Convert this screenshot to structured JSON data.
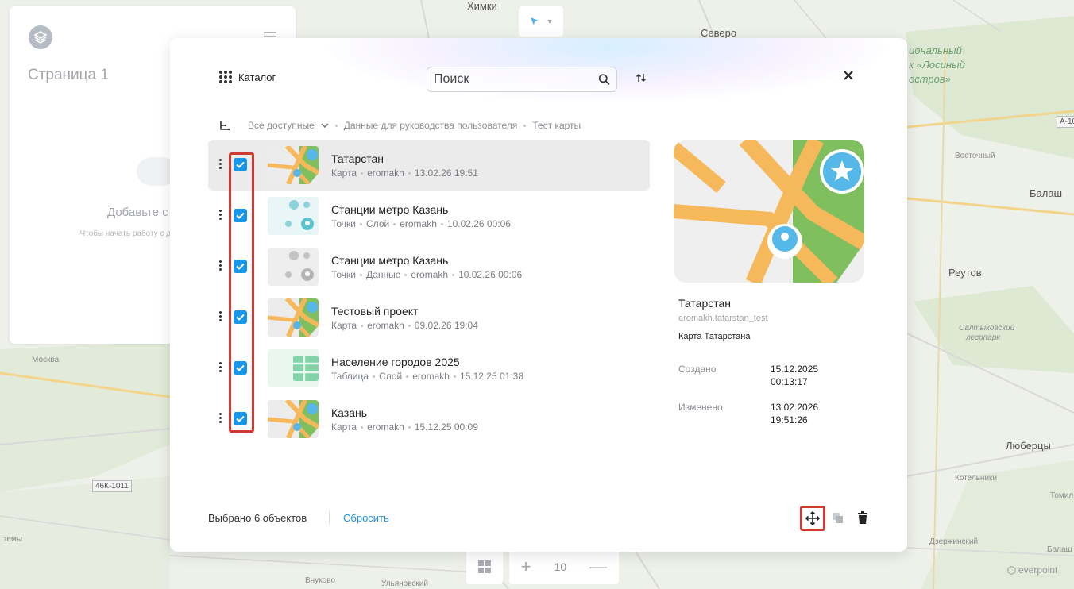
{
  "map": {
    "labels": {
      "khimki": "Химки",
      "severo": "Северо",
      "park_line1": "иональный",
      "park_line2": "к «Лосиный",
      "park_line3": "остров»",
      "vostochny": "Восточный",
      "balash": "Балаш",
      "reutov": "Реутов",
      "saltykovsky1": "Салтыковский",
      "saltykovsky2": "лесопарк",
      "lyubertsy": "Люберцы",
      "kotelniki": "Котельники",
      "tomil": "Томил",
      "dzerzhinsky": "Дзержинский",
      "balash2": "Балаш",
      "vnukovo": "Внуково",
      "ulyanovsky": "Ульяновский",
      "zemy": "земы",
      "moskva": "Москва",
      "road_46k": "46К-1011",
      "road_a10": "А-10"
    }
  },
  "left_panel": {
    "page_title": "Страница 1",
    "add_title": "Добавьте с",
    "hint": "Чтобы начать работу с добавьте слои к"
  },
  "bottom_controls": {
    "zoom_level": "10",
    "brand": "everpoint"
  },
  "catalog": {
    "title": "Каталог",
    "search_placeholder": "Поиск",
    "breadcrumb": {
      "root": "Все доступные",
      "items": [
        "Данные для руководства пользователя",
        "Тест карты"
      ]
    },
    "items": [
      {
        "name": "Татарстан",
        "meta": [
          "Карта",
          "eromakh",
          "13.02.26 19:51"
        ],
        "thumb": "map",
        "selected": true,
        "checked": true
      },
      {
        "name": "Станции метро Казань",
        "meta": [
          "Точки",
          "Слой",
          "eromakh",
          "10.02.26 00:06"
        ],
        "thumb": "points-teal",
        "selected": false,
        "checked": true
      },
      {
        "name": "Станции метро Казань",
        "meta": [
          "Точки",
          "Данные",
          "eromakh",
          "10.02.26 00:06"
        ],
        "thumb": "points-gray",
        "selected": false,
        "checked": true
      },
      {
        "name": "Тестовый проект",
        "meta": [
          "Карта",
          "eromakh",
          "09.02.26 19:04"
        ],
        "thumb": "map",
        "selected": false,
        "checked": true
      },
      {
        "name": "Население городов 2025",
        "meta": [
          "Таблица",
          "Слой",
          "eromakh",
          "15.12.25 01:38"
        ],
        "thumb": "table",
        "selected": false,
        "checked": true
      },
      {
        "name": "Казань",
        "meta": [
          "Карта",
          "eromakh",
          "15.12.25 00:09"
        ],
        "thumb": "map",
        "selected": false,
        "checked": true
      }
    ],
    "details": {
      "title": "Татарстан",
      "id": "eromakh.tatarstan_test",
      "description": "Карта Татарстана",
      "created_label": "Создано",
      "created_date": "15.12.2025",
      "created_time": "00:13:17",
      "modified_label": "Изменено",
      "modified_date": "13.02.2026",
      "modified_time": "19:51:26"
    },
    "footer": {
      "selected_text": "Выбрано 6 объектов",
      "reset_label": "Сбросить"
    }
  },
  "colors": {
    "accent": "#1a96e6",
    "highlight": "#d13a33",
    "map_orange": "#f5b85a",
    "map_green": "#7fbf5e",
    "map_blue": "#55b8e8"
  }
}
